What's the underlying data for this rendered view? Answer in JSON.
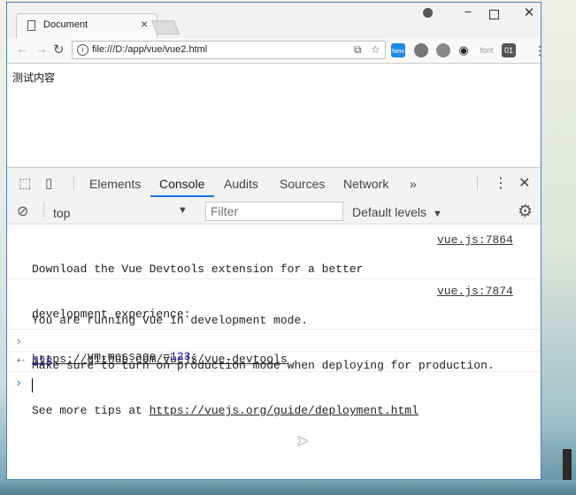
{
  "browser": {
    "tab_title": "Document",
    "tab_close": "×",
    "url": "file:///D:/app/vue/vue2.html",
    "min": "−",
    "close": "✕",
    "ext_new_badge": "New",
    "ext_font": "font",
    "ext_01": "01"
  },
  "page": {
    "text": "测试内容"
  },
  "devtools": {
    "tabs": [
      "Elements",
      "Console",
      "Audits",
      "Sources",
      "Network"
    ],
    "more": "»",
    "context": "top",
    "filter_placeholder": "Filter",
    "levels": "Default levels"
  },
  "console": {
    "msg1_line1": "Download the Vue Devtools extension for a better",
    "msg1_line2": "development experience:",
    "msg1_link": "https://github.com/vuejs/vue-devtools",
    "msg1_src": "vue.js:7864",
    "msg2_line1": "You are running Vue in development mode.",
    "msg2_line2": "Make sure to turn on production mode when deploying for production.",
    "msg2_line3_prefix": "See more tips at ",
    "msg2_link": "https://vuejs.org/guide/deployment.html",
    "msg2_src": "vue.js:7874",
    "input_cmd": "vm.message =",
    "input_value": "123",
    "input_suffix": ";",
    "result": "123"
  },
  "colors": {
    "accent": "#1a73e8",
    "number": "#1a1aa6",
    "window_border": "#4a7fbf"
  }
}
